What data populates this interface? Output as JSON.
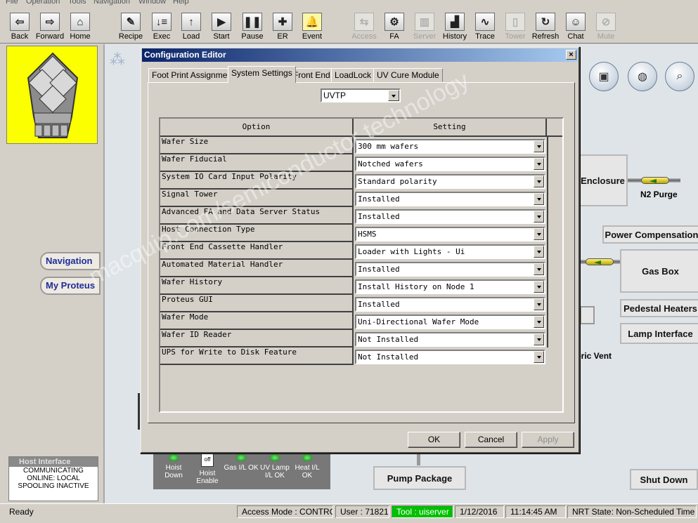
{
  "menu": [
    "File",
    "Operation",
    "Tools",
    "Navigation",
    "Window",
    "Help"
  ],
  "toolbar": [
    {
      "label": "Back",
      "icon": "back-arrow-icon",
      "glyph": "⇦",
      "enabled": true
    },
    {
      "label": "Forward",
      "icon": "forward-arrow-icon",
      "glyph": "⇨",
      "enabled": true
    },
    {
      "label": "Home",
      "icon": "home-icon",
      "glyph": "⌂",
      "enabled": true
    },
    {
      "label": "Recipe",
      "icon": "recipe-icon",
      "glyph": "✎",
      "enabled": true
    },
    {
      "label": "Exec",
      "icon": "exec-icon",
      "glyph": "↓≡",
      "enabled": true
    },
    {
      "label": "Load",
      "icon": "load-icon",
      "glyph": "↑",
      "enabled": true
    },
    {
      "label": "Start",
      "icon": "start-icon",
      "glyph": "▶",
      "enabled": true
    },
    {
      "label": "Pause",
      "icon": "pause-icon",
      "glyph": "❚❚",
      "enabled": true
    },
    {
      "label": "ER",
      "icon": "er-cross-icon",
      "glyph": "✚",
      "enabled": true
    },
    {
      "label": "Event",
      "icon": "bell-icon",
      "glyph": "🔔",
      "enabled": true
    },
    {
      "label": "Access",
      "icon": "access-icon",
      "glyph": "⇆",
      "enabled": false
    },
    {
      "label": "FA",
      "icon": "fa-gear-icon",
      "glyph": "⚙",
      "enabled": true
    },
    {
      "label": "Server",
      "icon": "server-icon",
      "glyph": "▥",
      "enabled": false
    },
    {
      "label": "History",
      "icon": "history-chart-icon",
      "glyph": "▟",
      "enabled": true
    },
    {
      "label": "Trace",
      "icon": "trace-chart-icon",
      "glyph": "∿",
      "enabled": true
    },
    {
      "label": "Tower",
      "icon": "tower-icon",
      "glyph": "▯",
      "enabled": false
    },
    {
      "label": "Refresh",
      "icon": "refresh-icon",
      "glyph": "↻",
      "enabled": true
    },
    {
      "label": "Chat",
      "icon": "chat-icon",
      "glyph": "☺",
      "enabled": true
    },
    {
      "label": "Mute",
      "icon": "mute-icon",
      "glyph": "⊘",
      "enabled": false
    }
  ],
  "sidebar": {
    "navigation": "Navigation",
    "my_proteus": "My Proteus"
  },
  "host_interface": {
    "title": "Host Interface",
    "lines": [
      "COMMUNICATING",
      "ONLINE: LOCAL",
      "SPOOLING INACTIVE"
    ]
  },
  "schematic": {
    "enclosure": "Enclosure",
    "n2_purge": "N2 Purge",
    "power_compensation": "Power Compensation",
    "gas_box": "Gas Box",
    "pedestal_heaters": "Pedestal Heaters",
    "lamp_interface": "Lamp Interface",
    "vent": "eric Vent",
    "pump_package": "Pump Package",
    "shut_down": "Shut Down"
  },
  "io_panel": [
    {
      "label": "Hoist Down",
      "kind": "led"
    },
    {
      "label": "Hoist Enable",
      "kind": "switch",
      "switch_text": "off"
    },
    {
      "label": "Gas I/L OK",
      "kind": "led"
    },
    {
      "label": "UV Lamp I/L OK",
      "kind": "led"
    },
    {
      "label": "Heat I/L OK",
      "kind": "led"
    }
  ],
  "dialog": {
    "title": "Configuration Editor",
    "close": "×",
    "tabs": [
      "Foot Print Assignment",
      "System Settings",
      "Front End",
      "LoadLock",
      "UV Cure Module"
    ],
    "active_tab": "System Settings",
    "selector_value": "UVTP",
    "grid": {
      "col_option": "Option",
      "col_setting": "Setting",
      "rows": [
        {
          "option": "Wafer Size",
          "setting": "300 mm wafers"
        },
        {
          "option": "Wafer Fiducial",
          "setting": "Notched wafers"
        },
        {
          "option": "System IO Card Input Polarity",
          "setting": "Standard polarity"
        },
        {
          "option": "Signal Tower",
          "setting": "Installed"
        },
        {
          "option": "Advanced FA and Data Server Status",
          "setting": "Installed"
        },
        {
          "option": "Host Connection Type",
          "setting": "HSMS"
        },
        {
          "option": "Front End Cassette Handler",
          "setting": "Loader with Lights - Ui"
        },
        {
          "option": "Automated Material Handler",
          "setting": "Installed"
        },
        {
          "option": "Wafer History",
          "setting": "Install History on Node 1"
        },
        {
          "option": "Proteus GUI",
          "setting": "Installed"
        },
        {
          "option": "Wafer Mode",
          "setting": "Uni-Directional Wafer Mode"
        },
        {
          "option": "Wafer ID Reader",
          "setting": "Not Installed"
        },
        {
          "option": "UPS for Write to Disk Feature",
          "setting": "Not Installed"
        }
      ]
    },
    "buttons": {
      "ok": "OK",
      "cancel": "Cancel",
      "apply": "Apply"
    }
  },
  "status": {
    "ready": "Ready",
    "access_mode": "Access Mode : CONTROL",
    "user": "User :  71821",
    "tool": "Tool :  uiserver",
    "date": "1/12/2016",
    "time": "11:14:45 AM",
    "nrt": "NRT State: Non-Scheduled Time"
  },
  "colors": {
    "tool_status_bg": "#00c000",
    "logo_bg": "#fbff00",
    "title_bar": "#0a246a"
  },
  "watermark": "macquip.com/semiconductor  technology"
}
